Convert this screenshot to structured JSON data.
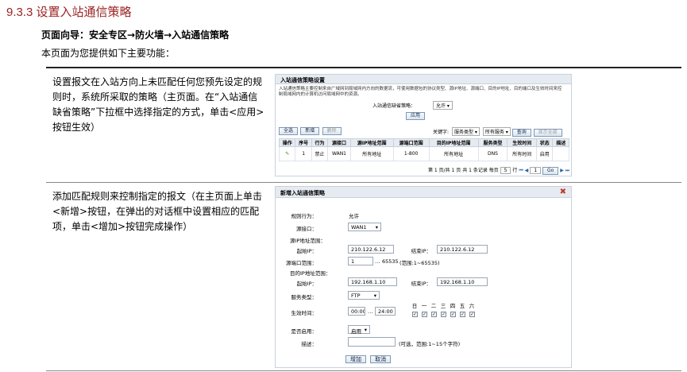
{
  "section_title": "9.3.3  设置入站通信策略",
  "nav": {
    "prefix": "页面向导：",
    "path": "安全专区→防火墙→入站通信策略"
  },
  "intro": "本页面为您提供如下主要功能：",
  "rows": [
    {
      "description": "设置报文在入站方向上未匹配任何您预先设定的规则时，系统所采取的策略（主页面。在“入站通信缺省策略”下拉框中选择指定的方式，单击<应用>按钮生效）"
    },
    {
      "description": "添加匹配规则来控制指定的报文（在主页面上单击<新增>按钮，在弹出的对话框中设置相应的匹配项，单击<增加>按钮完成操作）"
    }
  ],
  "main_page": {
    "title": "入站通信策略设置",
    "intro": "入站通信策略主要控制来自广域网到局域网内方向的数据流，可使用数据包的协议类型、源IP地址、源端口、目的IP地址、目的端口及生效时间来控制局域网内的计算机访问局域网中的资源。",
    "default_policy_label": "入站通信缺省策略：",
    "default_policy_value": "允许",
    "apply_button": "应用",
    "toolbar": {
      "select_all": "全选",
      "add": "新增",
      "delete": "删除"
    },
    "keyword_label": "关键字:",
    "keyword_type": "服务类型",
    "keyword_value": "所有服务",
    "search_button": "查询",
    "show_all_button": "显示全部",
    "columns": [
      "操作",
      "序号",
      "行为",
      "源接口",
      "源IP地址范围",
      "源端口范围",
      "目的IP地址范围",
      "服务类型",
      "生效时间",
      "状态",
      "描述"
    ],
    "rows": [
      {
        "op_icon": "pencil-icon",
        "index": "1",
        "action": "禁止",
        "iface": "WAN1",
        "src_ip": "所有地址",
        "src_port": "1-800",
        "dst_ip": "所有地址",
        "service": "DNS",
        "time": "所有时间",
        "status": "启用",
        "desc": ""
      }
    ],
    "pager": {
      "text": "第 1 页/共 1 页 共 1 条记录 每页",
      "per_page": "5",
      "row_label": "行",
      "page": "1",
      "go": "Go"
    }
  },
  "dialog": {
    "title": "新增入站通信策略",
    "action_label": "规则行为：",
    "action_value": "允许",
    "src_iface_label": "源接口：",
    "src_iface_value": "WAN1",
    "src_ip_range_label": "源IP地址范围：",
    "start_ip_label": "起始IP：",
    "end_ip_label": "结束IP：",
    "src_start_ip": "210.122.6.12",
    "src_end_ip": "210.122.6.12",
    "src_port_label": "源端口范围：",
    "src_port_start": "1",
    "src_port_sep": "…",
    "src_port_end": "65535",
    "src_port_hint": "(范围:1~65535)",
    "dst_ip_range_label": "目的IP地址范围：",
    "dst_start_ip": "192.168.1.10",
    "dst_end_ip": "192.168.1.10",
    "service_label": "服务类型：",
    "service_value": "FTP",
    "time_label": "生效时间：",
    "time_start": "00:00",
    "time_sep": "…",
    "time_end": "24:00",
    "days": [
      "日",
      "一",
      "二",
      "三",
      "四",
      "五",
      "六"
    ],
    "days_check": "✓",
    "enable_label": "是否启用：",
    "enable_value": "启用",
    "desc_label": "描述：",
    "desc_hint": "(可选，范围:1~15个字符)",
    "add_button": "增加",
    "cancel_button": "取消"
  }
}
